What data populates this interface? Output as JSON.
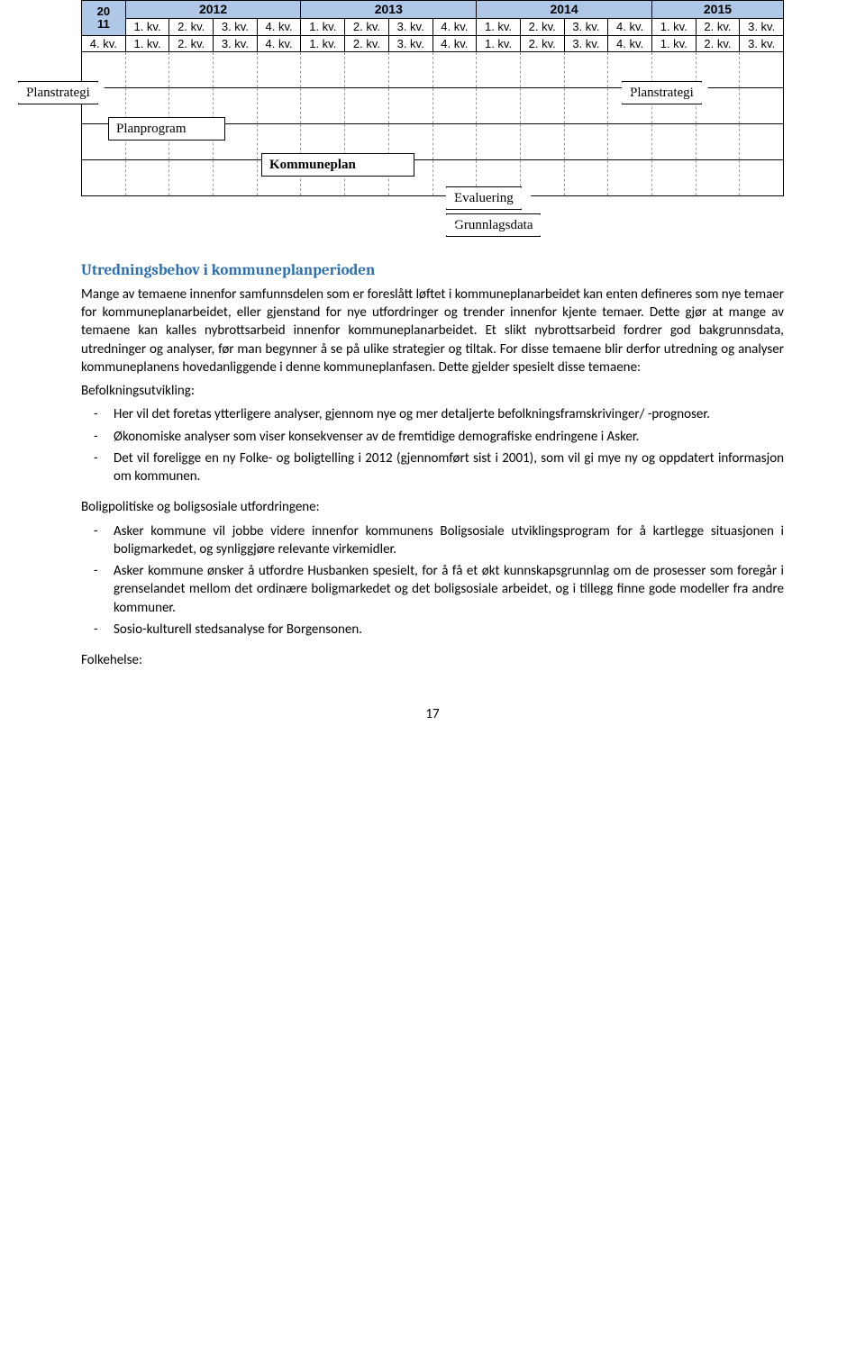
{
  "timeline": {
    "first_year_top": "20",
    "first_year_bottom": "11",
    "years": [
      "2012",
      "2013",
      "2014",
      "2015"
    ],
    "first_kv": "4. kv.",
    "kv": [
      "1. kv.",
      "2. kv.",
      "3. kv.",
      "4. kv."
    ],
    "kv2015": [
      "1. kv.",
      "2. kv.",
      "3. kv."
    ],
    "boxes": {
      "planstrategi1": "Planstrategi",
      "planstrategi2": "Planstrategi",
      "planprogram": "Planprogram",
      "kommuneplan": "Kommuneplan",
      "evaluering": "Evaluering",
      "grunnlagsdata": "Grunnlagsdata"
    }
  },
  "section": {
    "heading": "Utredningsbehov i kommuneplanperioden",
    "intro": "Mange av temaene innenfor samfunnsdelen som er foreslått løftet i kommuneplanarbeidet kan enten defineres som nye temaer for kommuneplanarbeidet, eller gjenstand for nye utfordringer og trender innenfor kjente temaer. Dette gjør at mange av temaene kan kalles nybrottsarbeid innenfor kommuneplanarbeidet. Et slikt nybrottsarbeid fordrer god bakgrunnsdata, utredninger og analyser, før man begynner å se på ulike strategier og tiltak. For disse temaene blir derfor utredning og analyser kommuneplanens hovedanliggende i denne kommuneplanfasen. Dette gjelder spesielt disse temaene:",
    "befolkning_label": "Befolkningsutvikling:",
    "befolkning_items": [
      "Her vil det foretas ytterligere analyser, gjennom nye og mer detaljerte befolkningsframskrivinger/ -prognoser.",
      "Økonomiske analyser som viser konsekvenser av de fremtidige demografiske endringene i Asker.",
      "Det vil foreligge en ny Folke- og boligtelling i 2012 (gjennomført sist i 2001), som vil gi mye ny og oppdatert informasjon om kommunen."
    ],
    "bolig_label": "Boligpolitiske og boligsosiale utfordringene:",
    "bolig_items": [
      "Asker kommune vil jobbe videre innenfor kommunens Boligsosiale utviklingsprogram for å kartlegge situasjonen i boligmarkedet, og synliggjøre relevante virkemidler.",
      "Asker kommune ønsker å utfordre Husbanken spesielt, for å få et økt kunnskapsgrunnlag om de prosesser som foregår i grenselandet mellom det ordinære boligmarkedet og det boligsosiale arbeidet, og i tillegg finne gode modeller fra andre kommuner.",
      "Sosio-kulturell stedsanalyse for Borgensonen."
    ],
    "folkehelse_label": "Folkehelse:"
  },
  "page_number": "17"
}
